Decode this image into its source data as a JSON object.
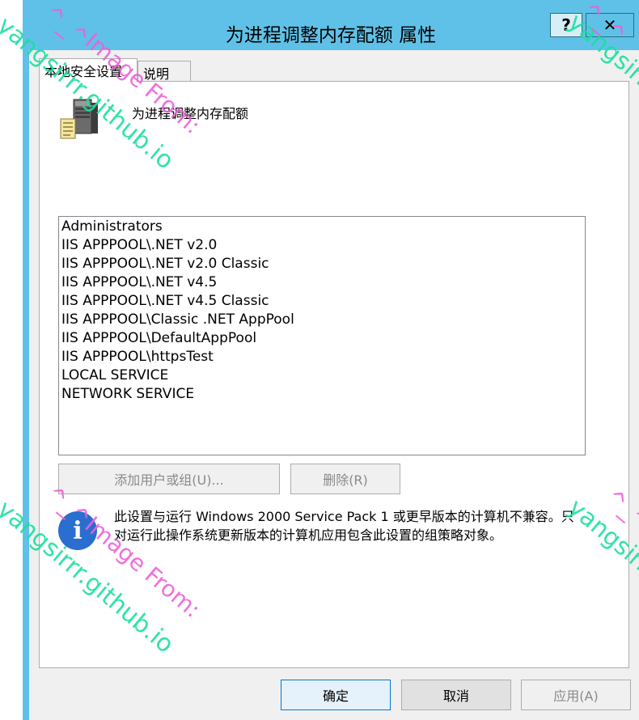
{
  "window": {
    "title": "为进程调整内存配额 属性",
    "help_glyph": "?",
    "close_glyph": "✕"
  },
  "tabs": [
    {
      "label": "本地安全设置",
      "active": true
    },
    {
      "label": "说明",
      "active": false
    }
  ],
  "policy": {
    "name": "为进程调整内存配额",
    "icon": "server-policy-icon"
  },
  "accounts": [
    "Administrators",
    "IIS APPPOOL\\.NET v2.0",
    "IIS APPPOOL\\.NET v2.0 Classic",
    "IIS APPPOOL\\.NET v4.5",
    "IIS APPPOOL\\.NET v4.5 Classic",
    "IIS APPPOOL\\Classic .NET AppPool",
    "IIS APPPOOL\\DefaultAppPool",
    "IIS APPPOOL\\httpsTest",
    "LOCAL SERVICE",
    "NETWORK SERVICE"
  ],
  "buttons": {
    "add": "添加用户或组(U)...",
    "remove": "删除(R)",
    "ok": "确定",
    "cancel": "取消",
    "apply": "应用(A)"
  },
  "info": {
    "icon": "info-icon",
    "text": "此设置与运行 Windows 2000 Service Pack 1 或更早版本的计算机不兼容。只对运行此操作系统更新版本的计算机应用包含此设置的组策略对象。"
  },
  "watermarks": [
    "yangsirrr.github.io",
    "Image From:",
    "yangsirrr.github.io",
    "Image From:",
    "yangsirrr",
    "yangsirrr",
    "^_^",
    "^_^",
    "^_^",
    "^_^"
  ],
  "colors": {
    "titlebar": "#5fc1e7",
    "info_icon": "#2a6ecf",
    "watermark_green": "#19e0a0",
    "watermark_pink": "#ef60d8"
  }
}
